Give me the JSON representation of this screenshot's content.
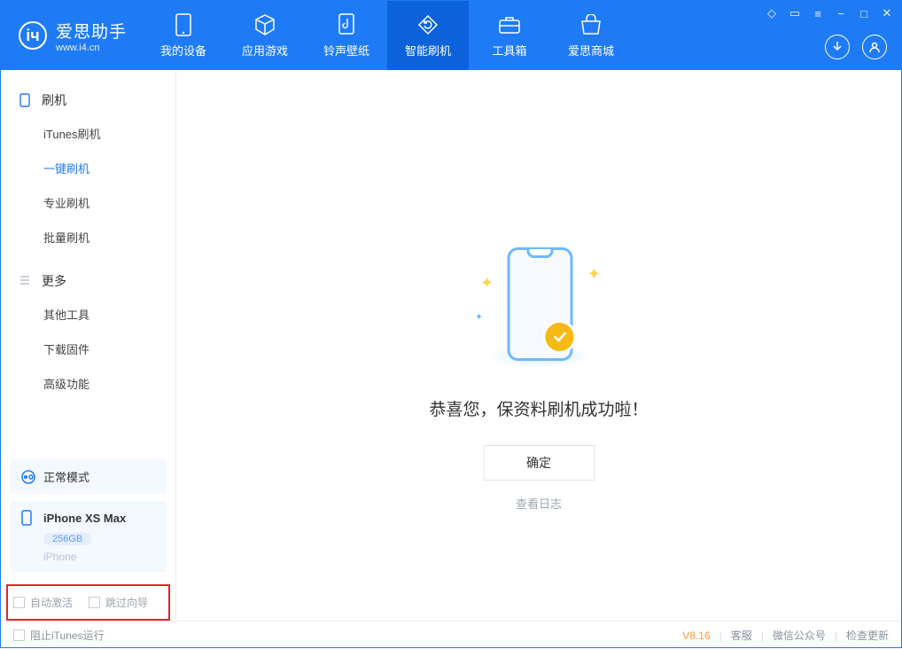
{
  "app": {
    "name_cn": "爱思助手",
    "name_en": "www.i4.cn"
  },
  "titlebar": {
    "store_icon": "store",
    "menu_icon": "menu",
    "list_icon": "list",
    "min": "−",
    "max": "□",
    "close": "✕"
  },
  "tabs": [
    {
      "label": "我的设备",
      "icon": "device"
    },
    {
      "label": "应用游戏",
      "icon": "cube"
    },
    {
      "label": "铃声壁纸",
      "icon": "music"
    },
    {
      "label": "智能刷机",
      "icon": "refresh",
      "active": true
    },
    {
      "label": "工具箱",
      "icon": "toolbox"
    },
    {
      "label": "爱思商城",
      "icon": "shop"
    }
  ],
  "header_actions": {
    "download": "download",
    "user": "user"
  },
  "sidebar": {
    "group1": {
      "title": "刷机",
      "items": [
        "iTunes刷机",
        "一键刷机",
        "专业刷机",
        "批量刷机"
      ],
      "active_index": 1
    },
    "group2": {
      "title": "更多",
      "items": [
        "其他工具",
        "下载固件",
        "高级功能"
      ]
    },
    "mode": "正常模式",
    "device": {
      "name": "iPhone XS Max",
      "storage": "256GB",
      "type": "iPhone"
    },
    "highlight": {
      "chk1": "自动激活",
      "chk2": "跳过向导"
    }
  },
  "main": {
    "success_text": "恭喜您，保资料刷机成功啦！",
    "ok_button": "确定",
    "log_link": "查看日志"
  },
  "footer": {
    "block_itunes": "阻止iTunes运行",
    "version": "V8.16",
    "links": [
      "客服",
      "微信公众号",
      "检查更新"
    ]
  }
}
